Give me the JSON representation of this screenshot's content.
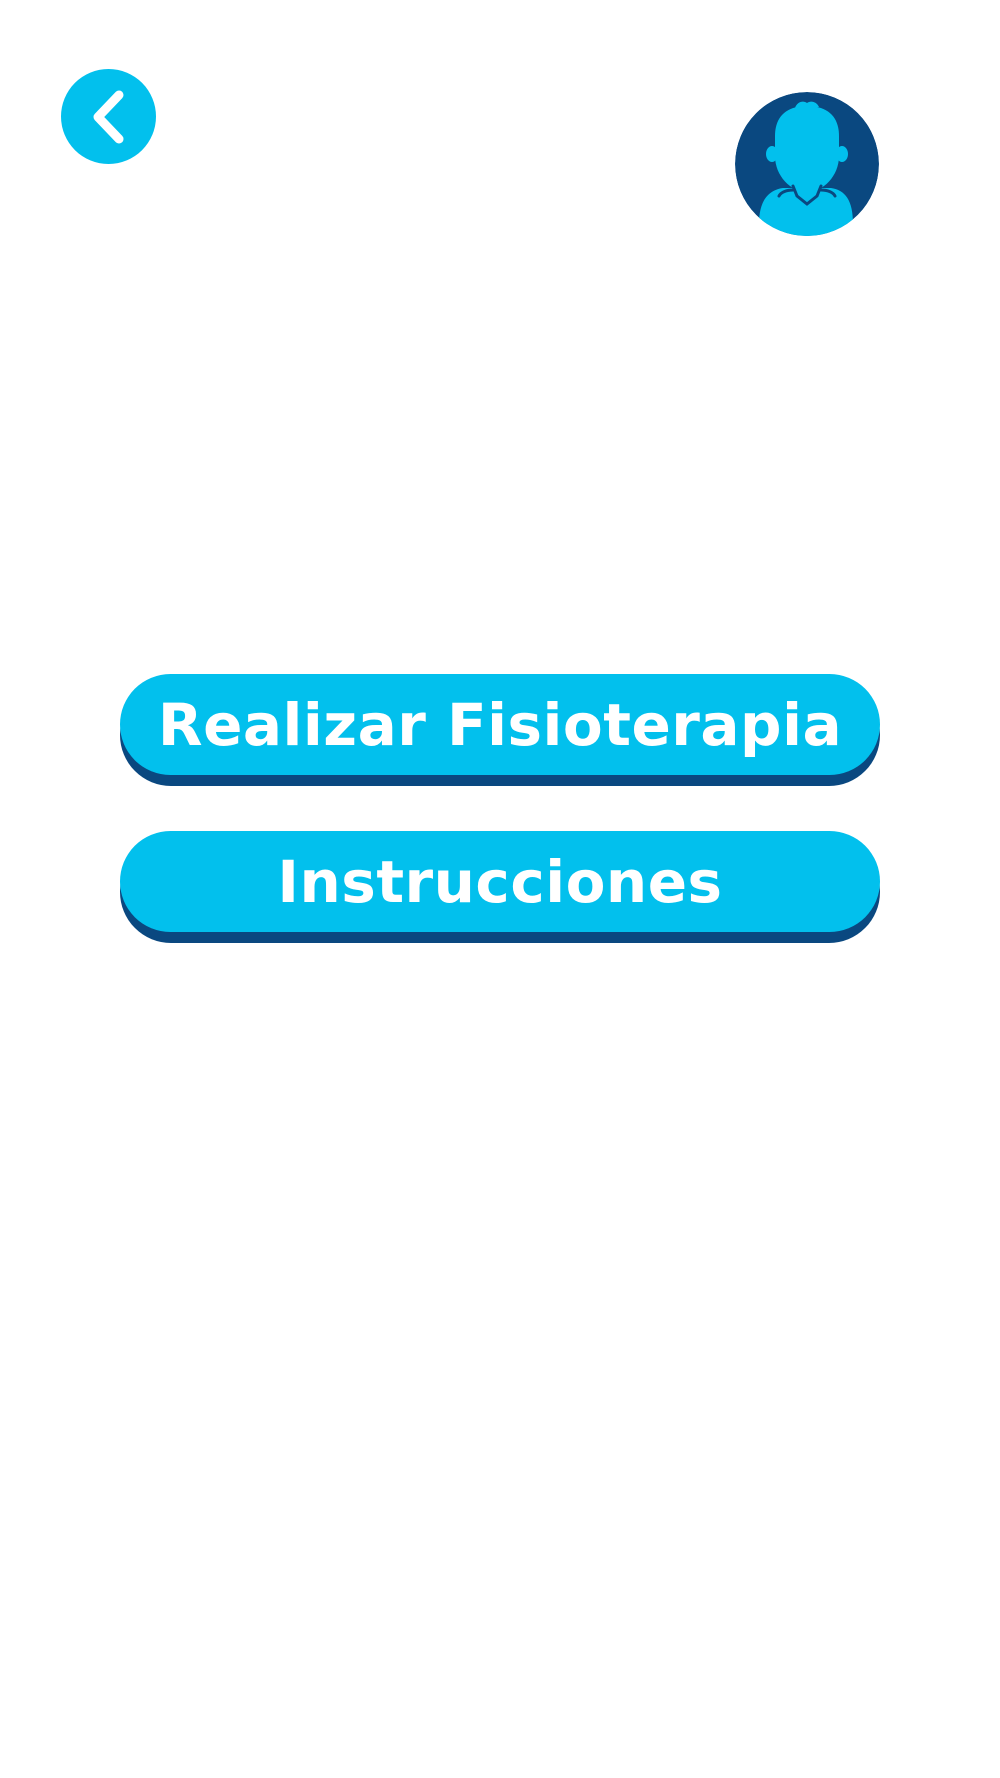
{
  "colors": {
    "primary": "#02c0ed",
    "primary_dark": "#0a4880",
    "icon_foreground": "#ffffff",
    "background": "#ffffff"
  },
  "header": {
    "back_icon": "chevron-left-icon",
    "avatar_icon": "user-silhouette-icon"
  },
  "menu": {
    "items": [
      {
        "label": "Realizar Fisioterapia"
      },
      {
        "label": "Instrucciones"
      }
    ]
  }
}
